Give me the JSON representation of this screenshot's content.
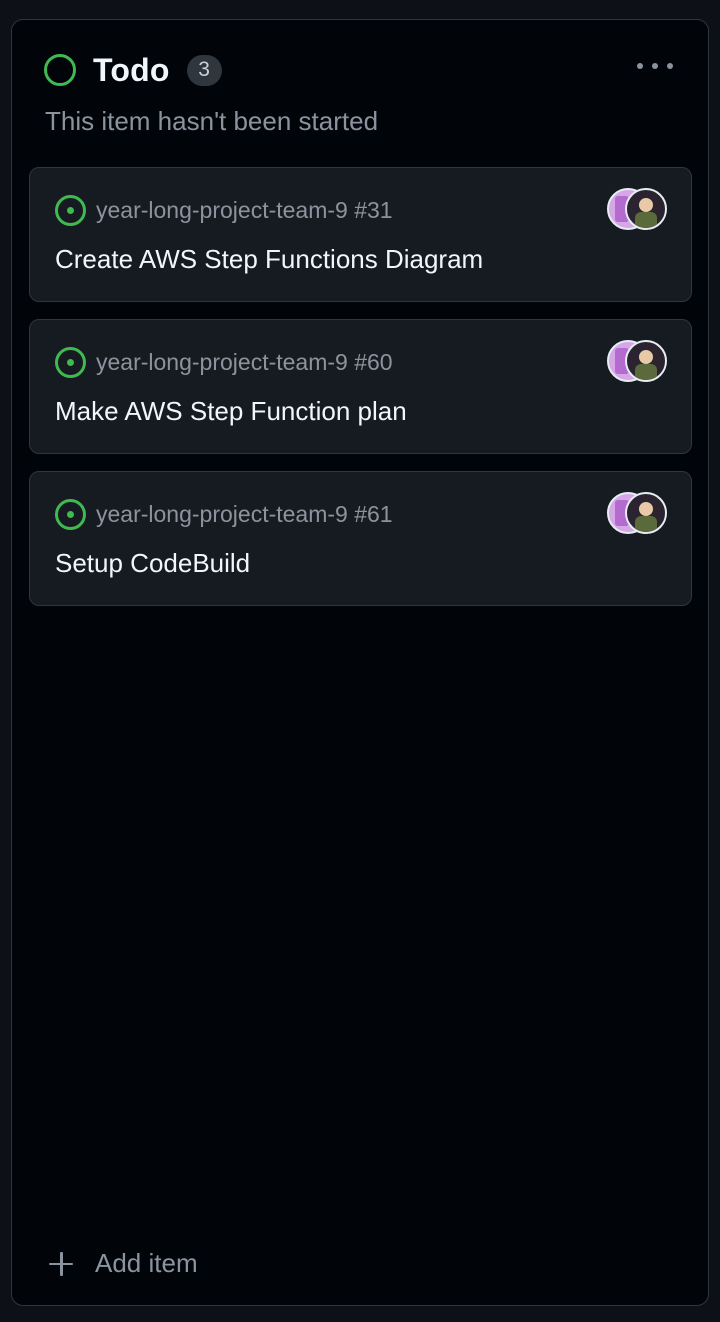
{
  "column": {
    "title": "Todo",
    "count": "3",
    "description": "This item hasn't been started",
    "status_color": "#3fb950",
    "menu_icon": "kebab-horizontal-icon"
  },
  "cards": [
    {
      "repo_ref": "year-long-project-team-9 #31",
      "title": "Create AWS Step Functions Diagram",
      "icon": "issue-open-icon"
    },
    {
      "repo_ref": "year-long-project-team-9 #60",
      "title": "Make AWS Step Function plan",
      "icon": "issue-open-icon"
    },
    {
      "repo_ref": "year-long-project-team-9 #61",
      "title": "Setup CodeBuild",
      "icon": "issue-open-icon"
    }
  ],
  "footer": {
    "add_label": "Add item",
    "add_icon": "plus-icon"
  },
  "colors": {
    "background": "#010409",
    "card": "#161b22",
    "border": "#30363d",
    "muted_text": "#8b949e"
  }
}
